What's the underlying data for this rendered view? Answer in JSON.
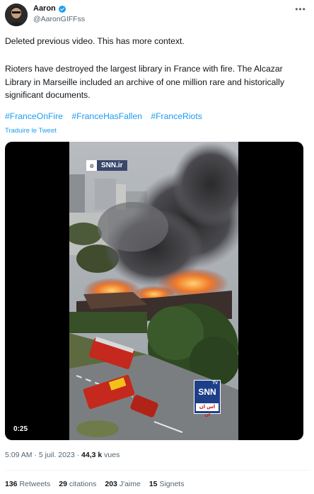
{
  "author": {
    "display_name": "Aaron",
    "handle": "@AaronGIFFss",
    "verified": true,
    "avatar_icon": "avatar-photo"
  },
  "tweet": {
    "line1": "Deleted previous video. This has more context.",
    "para2": "Rioters have destroyed the largest library in France with fire. The Alcazar Library in Marseille included an archive of one million rare and historically significant documents.",
    "hashtags": [
      "#FranceOnFire",
      "#FranceHasFallen",
      "#FranceRiots"
    ],
    "translate_label": "Traduire le Tweet"
  },
  "media": {
    "watermark_top": "SNN.ir",
    "logo_main": "SNN",
    "logo_tv": "TV",
    "logo_sub": "اس ان ان",
    "duration": "0:25"
  },
  "meta": {
    "time": "5:09 AM",
    "date": "5 juil. 2023",
    "views_count": "44,3 k",
    "views_label": "vues"
  },
  "stats": [
    {
      "count": "136",
      "label": "Retweets"
    },
    {
      "count": "29",
      "label": "citations"
    },
    {
      "count": "203",
      "label": "J'aime"
    },
    {
      "count": "15",
      "label": "Signets"
    }
  ],
  "colors": {
    "link": "#1d9bf0",
    "secondary_text": "#536471",
    "primary_text": "#0f1419",
    "verified": "#1d9bf0"
  }
}
